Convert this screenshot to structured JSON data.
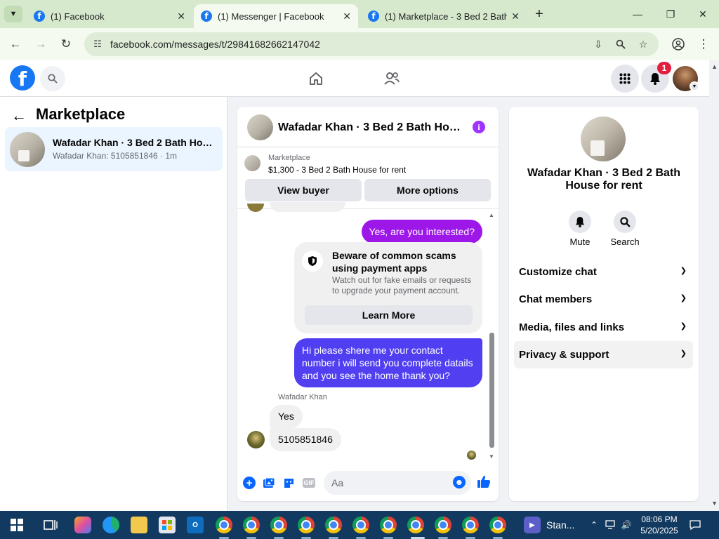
{
  "browser": {
    "tabs": [
      {
        "title": "(1) Facebook",
        "active": false
      },
      {
        "title": "(1) Messenger | Facebook",
        "active": true
      },
      {
        "title": "(1) Marketplace - 3 Bed 2 Bath Hou",
        "active": false
      }
    ],
    "url": "facebook.com/messages/t/29841682662147042"
  },
  "header": {
    "notification_count": "1"
  },
  "sidebar": {
    "title": "Marketplace",
    "conversations": [
      {
        "title": "Wafadar Khan · 3 Bed 2 Bath House for rent",
        "subtitle": "Wafadar Khan: 5105851846 · 1m"
      }
    ]
  },
  "chat": {
    "title": "Wafadar Khan · 3 Bed 2 Bath House for rent",
    "listing": {
      "label": "Marketplace",
      "price_title": "$1,300 - 3 Bed 2 Bath House for rent"
    },
    "buttons": {
      "view_buyer": "View buyer",
      "more_options": "More options"
    },
    "messages": {
      "outgoing_1": "Yes, are you interested?",
      "scam_title": "Beware of common scams using payment apps",
      "scam_desc": "Watch out for fake emails or requests to upgrade your payment account.",
      "learn_more": "Learn More",
      "outgoing_2": "Hi please shere me your contact number i will send you complete datails and you see the home thank you?",
      "sender": "Wafadar Khan",
      "incoming_1": "Yes",
      "incoming_2": "5105851846"
    },
    "composer": {
      "placeholder": "Aa"
    }
  },
  "details": {
    "title": "Wafadar Khan · 3 Bed 2 Bath House for rent",
    "actions": [
      {
        "label": "Mute"
      },
      {
        "label": "Search"
      }
    ],
    "sections": [
      {
        "label": "Customize chat"
      },
      {
        "label": "Chat members"
      },
      {
        "label": "Media, files and links"
      },
      {
        "label": "Privacy & support"
      }
    ]
  },
  "taskbar": {
    "pinned_app_text": "Stan...",
    "time": "08:06 PM",
    "date": "5/20/2025"
  },
  "colors": {
    "fb_blue": "#1877f2",
    "outgoing_purple": "#9d17e8",
    "outgoing_indigo": "#5240f0",
    "messenger_blue": "#0866ff"
  }
}
